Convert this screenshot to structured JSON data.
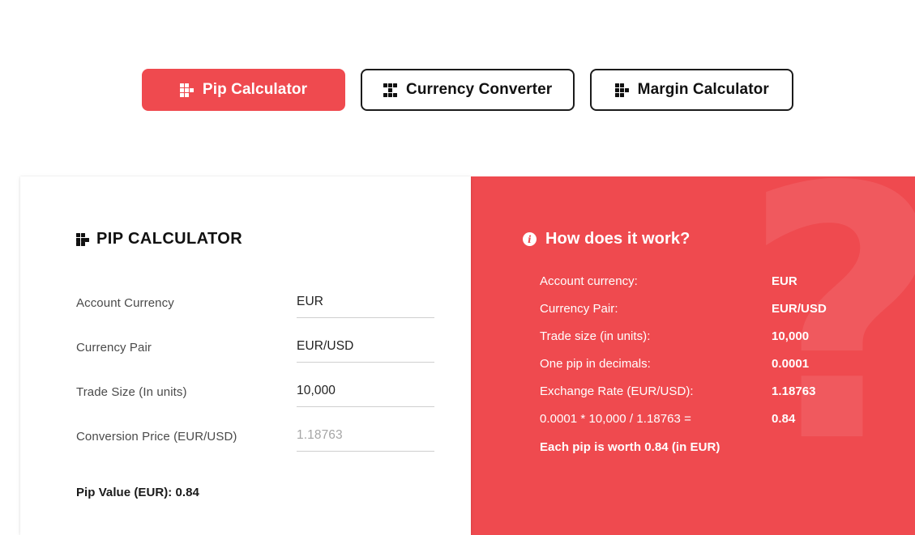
{
  "theme": {
    "accent": "#ef4a4f",
    "text_dark": "#111111",
    "label_gray": "#4a4a4a",
    "placeholder_gray": "#a6a6a6",
    "underline_gray": "#cfcfcf"
  },
  "tabs": [
    {
      "label": "Pip Calculator",
      "icon": "grid-pip-icon",
      "active": true
    },
    {
      "label": "Currency Converter",
      "icon": "grid-converter-icon",
      "active": false
    },
    {
      "label": "Margin Calculator",
      "icon": "grid-margin-icon",
      "active": false
    }
  ],
  "calculator": {
    "title": "PIP CALCULATOR",
    "title_icon": "grid-pip-icon",
    "fields": [
      {
        "label": "Account Currency",
        "value": "EUR",
        "is_placeholder": false
      },
      {
        "label": "Currency Pair",
        "value": "EUR/USD",
        "is_placeholder": false
      },
      {
        "label": "Trade Size (In units)",
        "value": "10,000",
        "is_placeholder": false
      },
      {
        "label": "Conversion Price (EUR/USD)",
        "value": "1.18763",
        "is_placeholder": true
      }
    ],
    "result": "Pip Value (EUR): 0.84"
  },
  "explainer": {
    "title": "How does it work?",
    "title_icon": "info-icon",
    "watermark": "?",
    "rows": [
      {
        "label": "Account currency:",
        "value": "EUR"
      },
      {
        "label": "Currency Pair:",
        "value": "EUR/USD"
      },
      {
        "label": "Trade size (in units):",
        "value": "10,000"
      },
      {
        "label": "One pip in decimals:",
        "value": "0.0001"
      },
      {
        "label": "Exchange Rate (EUR/USD):",
        "value": "1.18763"
      },
      {
        "label": "0.0001 * 10,000 / 1.18763 =",
        "value": "0.84"
      }
    ],
    "conclusion": "Each pip is worth 0.84 (in EUR)"
  }
}
